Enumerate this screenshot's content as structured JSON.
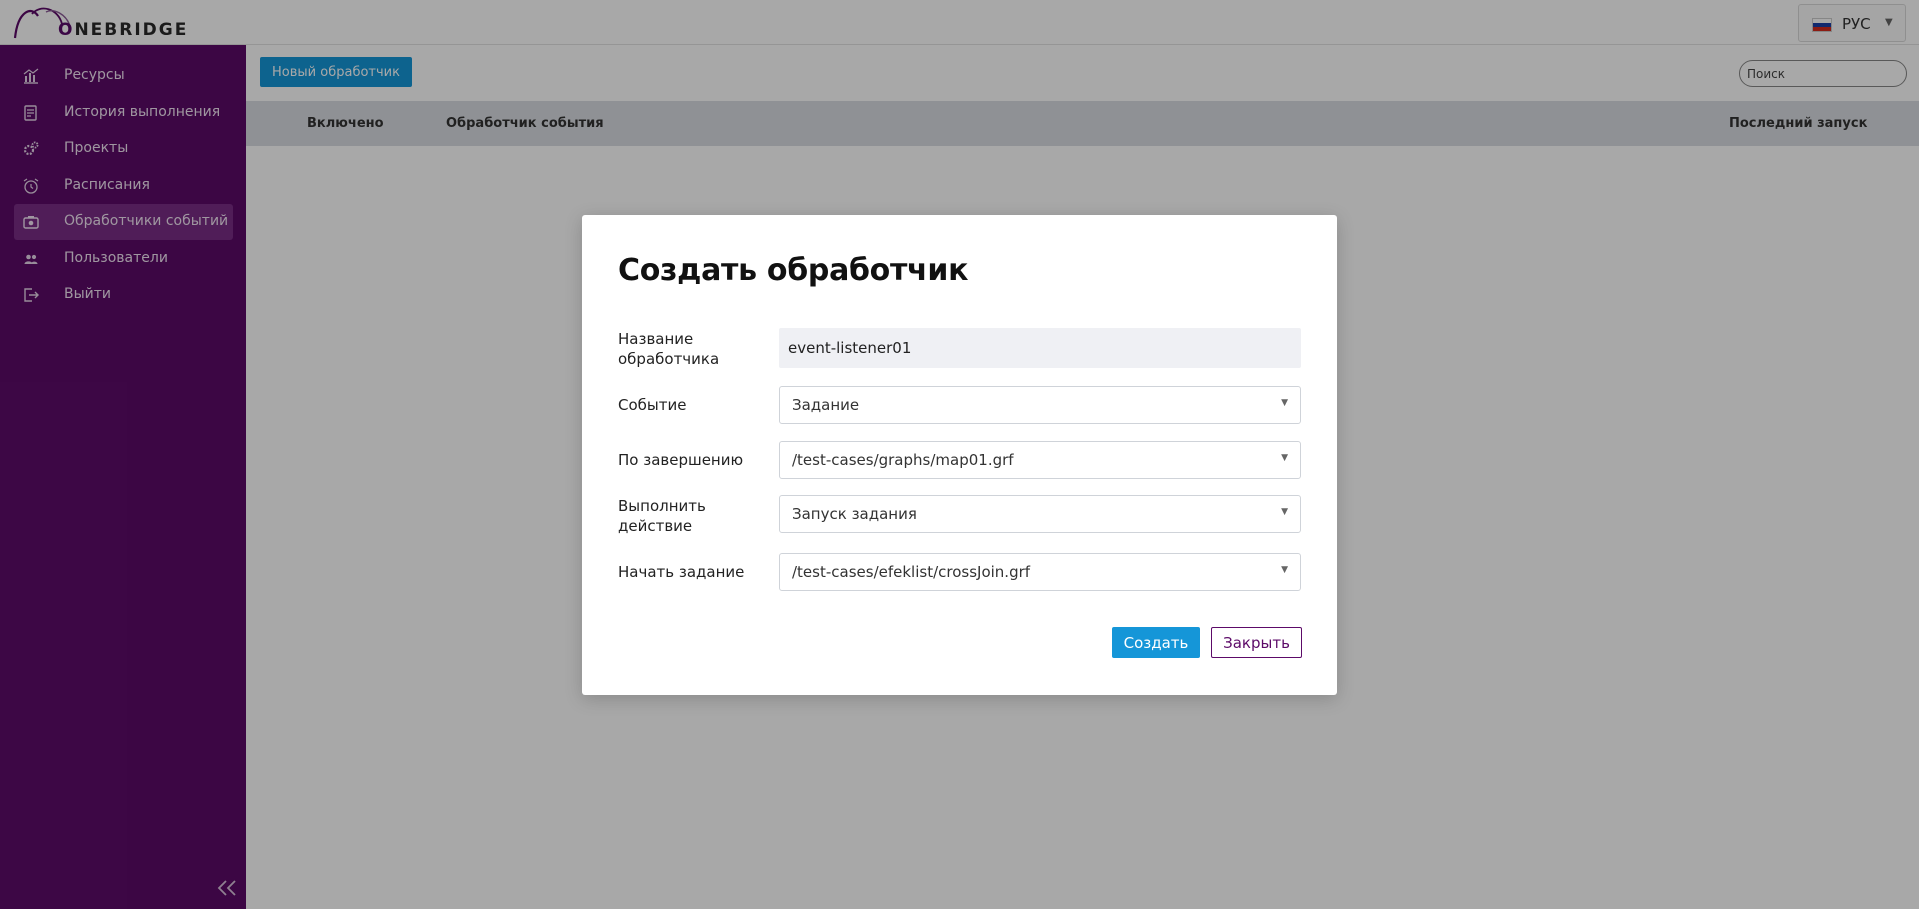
{
  "brand": {
    "logo_text_accent": "O",
    "logo_text_rest": "NEBRIDGE",
    "accent_color": "#5c0a68",
    "primary_button_color": "#1596d8"
  },
  "header": {
    "language": {
      "label": "РУС",
      "flag_icon": "russia-flag-icon",
      "flag_colors": [
        "#ffffff",
        "#1c3fa8",
        "#d52b1e"
      ]
    }
  },
  "sidebar": {
    "items": [
      {
        "label": "Ресурсы",
        "icon": "bar-chart-icon",
        "active": false
      },
      {
        "label": "История выполнения",
        "icon": "document-icon",
        "active": false
      },
      {
        "label": "Проекты",
        "icon": "gears-icon",
        "active": false
      },
      {
        "label": "Расписания",
        "icon": "alarm-clock-icon",
        "active": false
      },
      {
        "label": "Обработчики событий",
        "icon": "camera-icon",
        "active": true
      },
      {
        "label": "Пользователи",
        "icon": "users-icon",
        "active": false
      },
      {
        "label": "Выйти",
        "icon": "logout-icon",
        "active": false
      }
    ],
    "collapse_icon": "double-chevron-left-icon"
  },
  "main": {
    "toolbar": {
      "new_button_label": "Новый обработчик",
      "search_placeholder": "Поиск"
    },
    "table": {
      "columns": [
        "Включено",
        "Обработчик события",
        "Последний запуск"
      ]
    }
  },
  "modal": {
    "title": "Создать обработчик",
    "fields": {
      "name": {
        "label": "Название обработчика",
        "value": "event-listener01"
      },
      "event": {
        "label": "Событие",
        "value": "Задание"
      },
      "on_completion": {
        "label": "По завершению",
        "value": "/test-cases/graphs/map01.grf"
      },
      "action": {
        "label": "Выполнить действие",
        "value": "Запуск задания"
      },
      "start_job": {
        "label": "Начать задание",
        "value": "/test-cases/efeklist/crossJoin.grf"
      }
    },
    "buttons": {
      "create": "Создать",
      "close": "Закрыть"
    }
  }
}
